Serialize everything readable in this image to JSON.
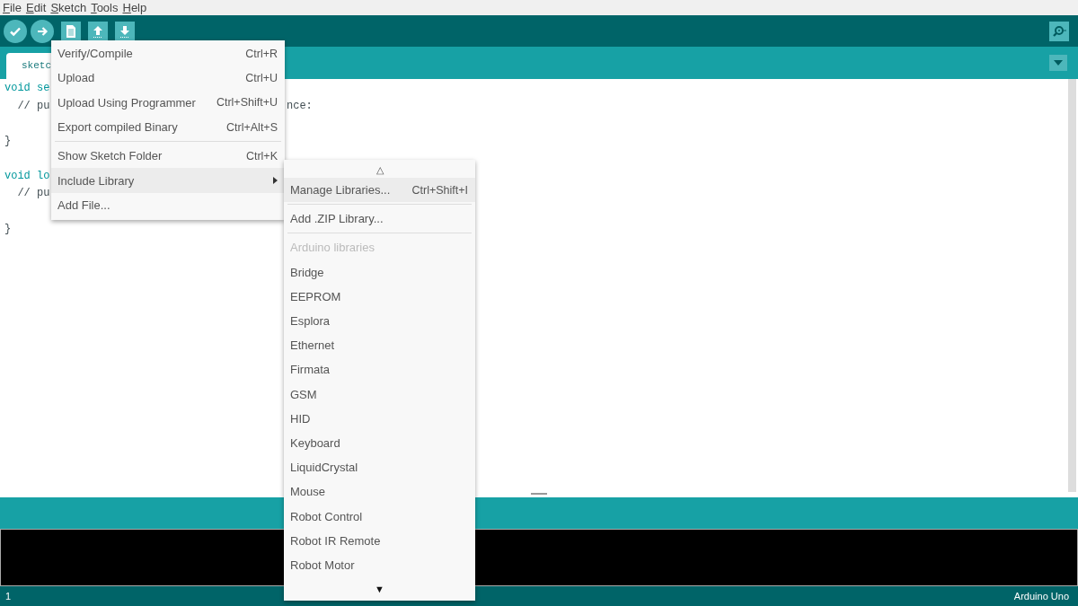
{
  "menu_bar": [
    {
      "label": "File"
    },
    {
      "label": "Edit"
    },
    {
      "label": "Sketch"
    },
    {
      "label": "Tools"
    },
    {
      "label": "Help"
    }
  ],
  "toolbar": [
    {
      "kind": "verify"
    },
    {
      "kind": "upload"
    },
    {
      "kind": "new"
    },
    {
      "kind": "open"
    },
    {
      "kind": "save"
    }
  ],
  "tabs": [
    {
      "label": "sketc",
      "selected": true
    }
  ],
  "code_lines": [
    {
      "left": "void se",
      "blank_before": false
    },
    {
      "left": "  // pu",
      "right": "nce:",
      "blank_before": false
    },
    {
      "left": "}",
      "blank_before": true
    },
    {
      "left": "void lo",
      "blank_before": true
    },
    {
      "left": "  // pu",
      "blank_before": false
    },
    {
      "left": "}",
      "blank_before": true
    }
  ],
  "sketch_menu": [
    {
      "label": "Verify/Compile",
      "shortcut": "Ctrl+R",
      "kind": "item",
      "selected": false
    },
    {
      "label": "Upload",
      "shortcut": "Ctrl+U",
      "kind": "item",
      "selected": false
    },
    {
      "label": "Upload Using Programmer",
      "shortcut": "Ctrl+Shift+U",
      "kind": "item",
      "selected": false
    },
    {
      "label": "Export compiled Binary",
      "shortcut": "Ctrl+Alt+S",
      "kind": "item",
      "selected": false
    },
    {
      "kind": "separator"
    },
    {
      "label": "Show Sketch Folder",
      "shortcut": "Ctrl+K",
      "kind": "item",
      "selected": false
    },
    {
      "label": "Include Library",
      "kind": "submenu",
      "selected": true
    },
    {
      "label": "Add File...",
      "kind": "item",
      "selected": false
    }
  ],
  "library_submenu": {
    "scroll_up": "△",
    "scroll_down": "▼",
    "items": [
      {
        "label": "Manage Libraries...",
        "shortcut": "Ctrl+Shift+I",
        "kind": "item",
        "selected": true,
        "disabled": false
      },
      {
        "kind": "separator"
      },
      {
        "label": "Add .ZIP Library...",
        "kind": "item",
        "selected": false,
        "disabled": false
      },
      {
        "kind": "separator"
      },
      {
        "label": "Arduino libraries",
        "kind": "item",
        "selected": false,
        "disabled": true
      },
      {
        "label": "Bridge",
        "kind": "item",
        "selected": false,
        "disabled": false
      },
      {
        "label": "EEPROM",
        "kind": "item",
        "selected": false,
        "disabled": false
      },
      {
        "label": "Esplora",
        "kind": "item",
        "selected": false,
        "disabled": false
      },
      {
        "label": "Ethernet",
        "kind": "item",
        "selected": false,
        "disabled": false
      },
      {
        "label": "Firmata",
        "kind": "item",
        "selected": false,
        "disabled": false
      },
      {
        "label": "GSM",
        "kind": "item",
        "selected": false,
        "disabled": false
      },
      {
        "label": "HID",
        "kind": "item",
        "selected": false,
        "disabled": false
      },
      {
        "label": "Keyboard",
        "kind": "item",
        "selected": false,
        "disabled": false
      },
      {
        "label": "LiquidCrystal",
        "kind": "item",
        "selected": false,
        "disabled": false
      },
      {
        "label": "Mouse",
        "kind": "item",
        "selected": false,
        "disabled": false
      },
      {
        "label": "Robot Control",
        "kind": "item",
        "selected": false,
        "disabled": false
      },
      {
        "label": "Robot IR Remote",
        "kind": "item",
        "selected": false,
        "disabled": false
      },
      {
        "label": "Robot Motor",
        "kind": "item",
        "selected": false,
        "disabled": false
      }
    ]
  },
  "status_bar": {
    "line": "1",
    "board": "Arduino Uno"
  }
}
